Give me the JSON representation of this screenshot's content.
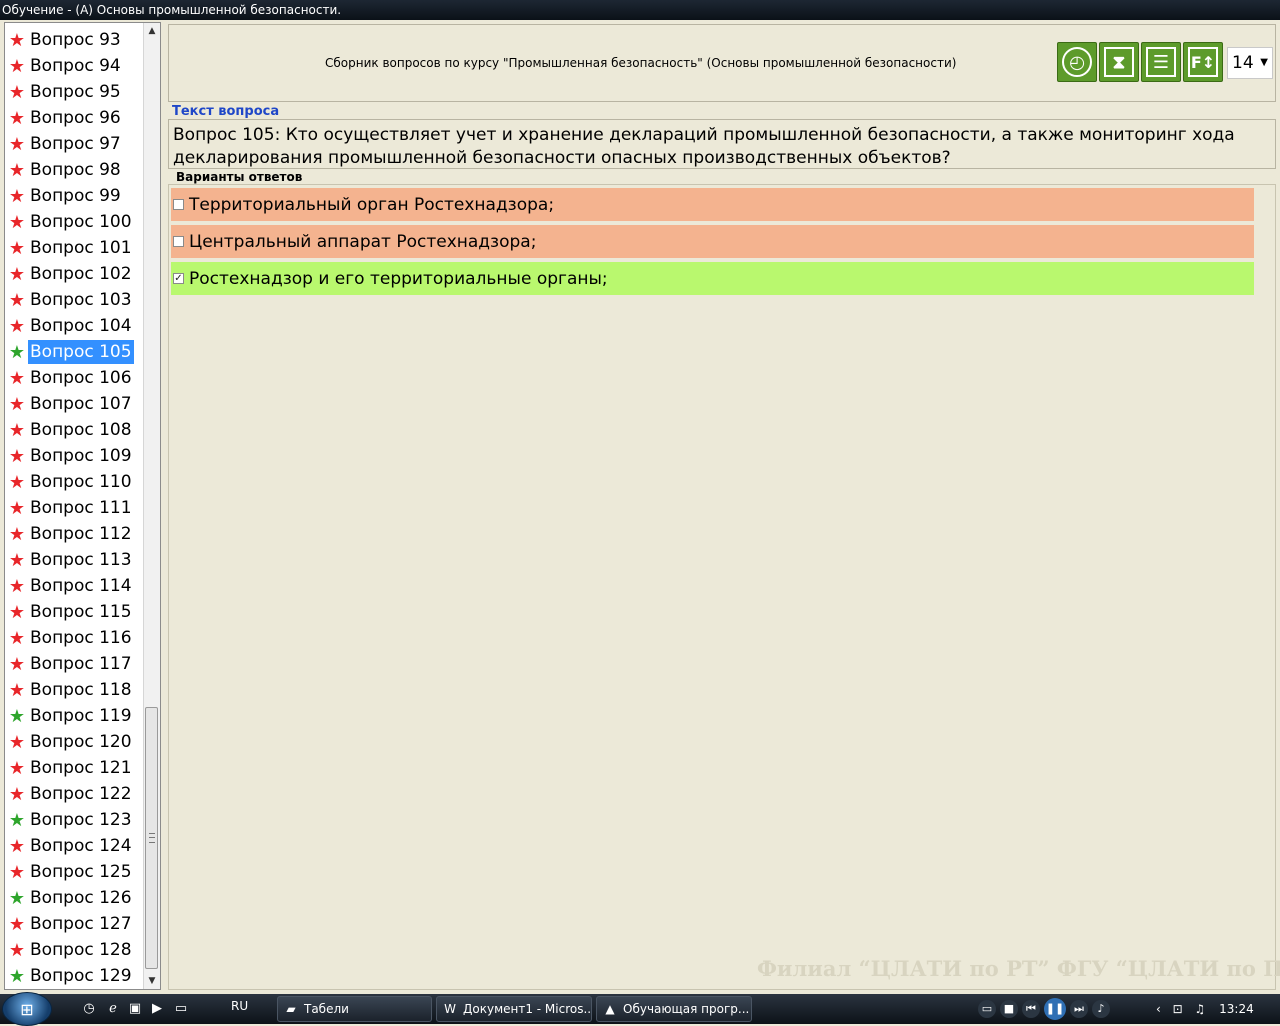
{
  "window": {
    "title": "Обучение - (А) Основы промышленной безопасности."
  },
  "sidebar": {
    "items": [
      {
        "label": "Вопрос 93",
        "status": "red"
      },
      {
        "label": "Вопрос 94",
        "status": "red"
      },
      {
        "label": "Вопрос 95",
        "status": "red"
      },
      {
        "label": "Вопрос 96",
        "status": "red"
      },
      {
        "label": "Вопрос 97",
        "status": "red"
      },
      {
        "label": "Вопрос 98",
        "status": "red"
      },
      {
        "label": "Вопрос 99",
        "status": "red"
      },
      {
        "label": "Вопрос 100",
        "status": "red"
      },
      {
        "label": "Вопрос 101",
        "status": "red"
      },
      {
        "label": "Вопрос 102",
        "status": "red"
      },
      {
        "label": "Вопрос 103",
        "status": "red"
      },
      {
        "label": "Вопрос 104",
        "status": "red"
      },
      {
        "label": "Вопрос 105",
        "status": "green",
        "selected": true
      },
      {
        "label": "Вопрос 106",
        "status": "red"
      },
      {
        "label": "Вопрос 107",
        "status": "red"
      },
      {
        "label": "Вопрос 108",
        "status": "red"
      },
      {
        "label": "Вопрос 109",
        "status": "red"
      },
      {
        "label": "Вопрос 110",
        "status": "red"
      },
      {
        "label": "Вопрос 111",
        "status": "red"
      },
      {
        "label": "Вопрос 112",
        "status": "red"
      },
      {
        "label": "Вопрос 113",
        "status": "red"
      },
      {
        "label": "Вопрос 114",
        "status": "red"
      },
      {
        "label": "Вопрос 115",
        "status": "red"
      },
      {
        "label": "Вопрос 116",
        "status": "red"
      },
      {
        "label": "Вопрос 117",
        "status": "red"
      },
      {
        "label": "Вопрос 118",
        "status": "red"
      },
      {
        "label": "Вопрос 119",
        "status": "green"
      },
      {
        "label": "Вопрос 120",
        "status": "red"
      },
      {
        "label": "Вопрос 121",
        "status": "red"
      },
      {
        "label": "Вопрос 122",
        "status": "red"
      },
      {
        "label": "Вопрос 123",
        "status": "green"
      },
      {
        "label": "Вопрос 124",
        "status": "red"
      },
      {
        "label": "Вопрос 125",
        "status": "red"
      },
      {
        "label": "Вопрос 126",
        "status": "green"
      },
      {
        "label": "Вопрос 127",
        "status": "red"
      },
      {
        "label": "Вопрос 128",
        "status": "red"
      },
      {
        "label": "Вопрос 129",
        "status": "green"
      }
    ]
  },
  "header": {
    "collection_title": "Сборник вопросов по курсу \"Промышленная безопасность\" (Основы промышленной безопасности)",
    "font_size": "14",
    "tool_icons": [
      "clock-icon",
      "hourglass-icon",
      "list-icon",
      "font-size-icon"
    ]
  },
  "question": {
    "section_label": "Текст вопроса",
    "line1": "Вопрос 105: Кто осуществляет учет и хранение деклараций промышленной безопасности, а также мониторинг хода",
    "line2": "декларирования промышленной безопасности опасных производственных объектов?"
  },
  "answers": {
    "section_label": "Варианты ответов",
    "items": [
      {
        "text": "Территориальный орган Ростехнадзора;",
        "checked": false,
        "state": "wrong"
      },
      {
        "text": "Центральный аппарат Ростехнадзора;",
        "checked": false,
        "state": "wrong"
      },
      {
        "text": "Ростехнадзор и его территориальные органы;",
        "checked": true,
        "state": "right"
      }
    ]
  },
  "watermark": "Филиал “ЦЛАТИ по РТ” ФГУ “ЦЛАТИ по ПФО”",
  "taskbar": {
    "language": "RU",
    "tasks": [
      {
        "label": "Табели",
        "icon": "folder-icon"
      },
      {
        "label": "Документ1 - Micros...",
        "icon": "word-icon"
      },
      {
        "label": "Обучающая прогр...",
        "icon": "app-icon"
      }
    ],
    "clock": "13:24"
  },
  "colors": {
    "wrong_answer": "#f4b38f",
    "right_answer": "#b9f86e",
    "star_red": "#e8262a",
    "star_green": "#2ea52c",
    "selection": "#3390ff",
    "section_label": "#1f47c8"
  }
}
